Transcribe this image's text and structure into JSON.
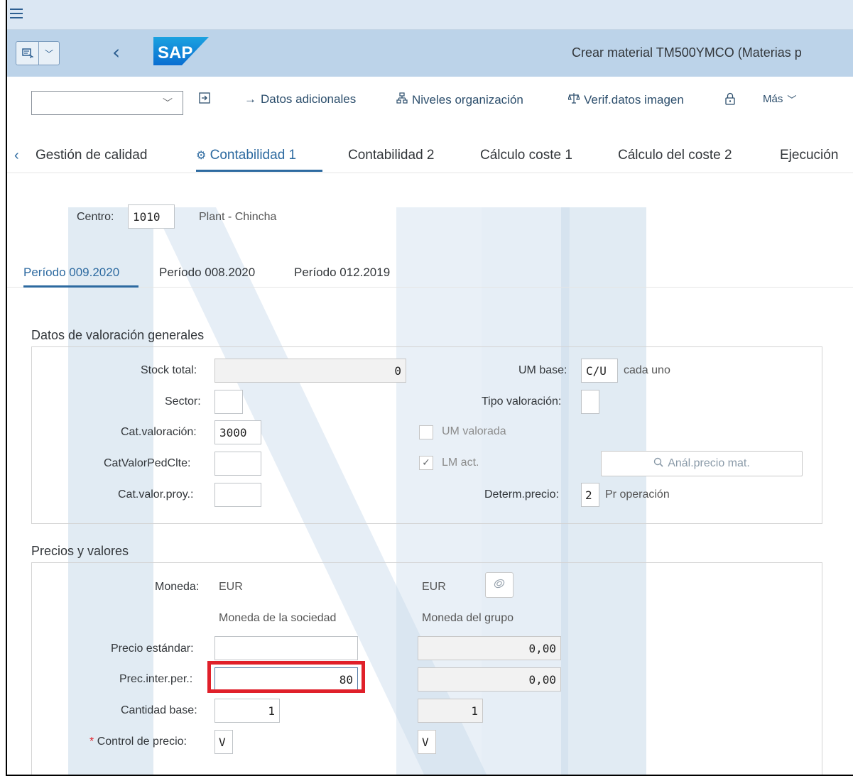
{
  "shell": {
    "menu_icon": "hamburger-icon",
    "back_icon": "chevron-left-icon",
    "logo_text": "SAP",
    "title": "Crear material TM500YMCO (Materias p"
  },
  "toolbar": {
    "select_value": "",
    "datos_adicionales": "Datos adicionales",
    "niveles_organizacion": "Niveles organización",
    "verif_datos_imagen": "Verif.datos imagen",
    "mas": "Más"
  },
  "section_tabs": {
    "items": [
      "Gestión de calidad",
      "Contabilidad 1",
      "Contabilidad 2",
      "Cálculo coste 1",
      "Cálculo del coste 2",
      "Ejecución"
    ],
    "active": "Contabilidad 1"
  },
  "centro": {
    "label": "Centro:",
    "value": "1010",
    "description": "Plant - Chincha"
  },
  "period_tabs": {
    "items": [
      "Período 009.2020",
      "Período 008.2020",
      "Período 012.2019"
    ],
    "active": "Período 009.2020"
  },
  "valoracion": {
    "title": "Datos de valoración generales",
    "stock_total_label": "Stock total:",
    "stock_total_value": "0",
    "sector_label": "Sector:",
    "sector_value": "",
    "cat_valoracion_label": "Cat.valoración:",
    "cat_valoracion_value": "3000",
    "cat_valor_ped_clte_label": "CatValorPedClte:",
    "cat_valor_ped_clte_value": "",
    "cat_valor_proy_label": "Cat.valor.proy.:",
    "cat_valor_proy_value": "",
    "um_base_label": "UM base:",
    "um_base_value": "C/U",
    "um_base_text": "cada uno",
    "tipo_valoracion_label": "Tipo valoración:",
    "tipo_valoracion_value": "",
    "um_valorada_label": "UM valorada",
    "um_valorada_checked": false,
    "lm_act_label": "LM act.",
    "lm_act_checked": true,
    "anal_precio_label": "Anál.precio mat.",
    "determ_precio_label": "Determ.precio:",
    "determ_precio_value": "2",
    "determ_precio_text": "Pr operación"
  },
  "precios": {
    "title": "Precios y valores",
    "moneda_label": "Moneda:",
    "moneda_sociedad_value": "EUR",
    "moneda_grupo_value": "EUR",
    "col_sociedad": "Moneda de la sociedad",
    "col_grupo": "Moneda del grupo",
    "precio_estandar_label": "Precio estándar:",
    "precio_estandar_sociedad": "",
    "precio_estandar_grupo": "0,00",
    "prec_inter_per_label": "Prec.inter.per.:",
    "prec_inter_per_sociedad": "80",
    "prec_inter_per_grupo": "0,00",
    "cantidad_base_label": "Cantidad base:",
    "cantidad_base_sociedad": "1",
    "cantidad_base_grupo": "1",
    "control_precio_label": "Control de precio:",
    "control_precio_sociedad": "V",
    "control_precio_grupo": "V",
    "required_marker": "*"
  },
  "colors": {
    "shell_bg": "#bcd3e9",
    "accent": "#2d6aa0",
    "highlight": "#e0202a",
    "watermark": "#c8daea"
  }
}
